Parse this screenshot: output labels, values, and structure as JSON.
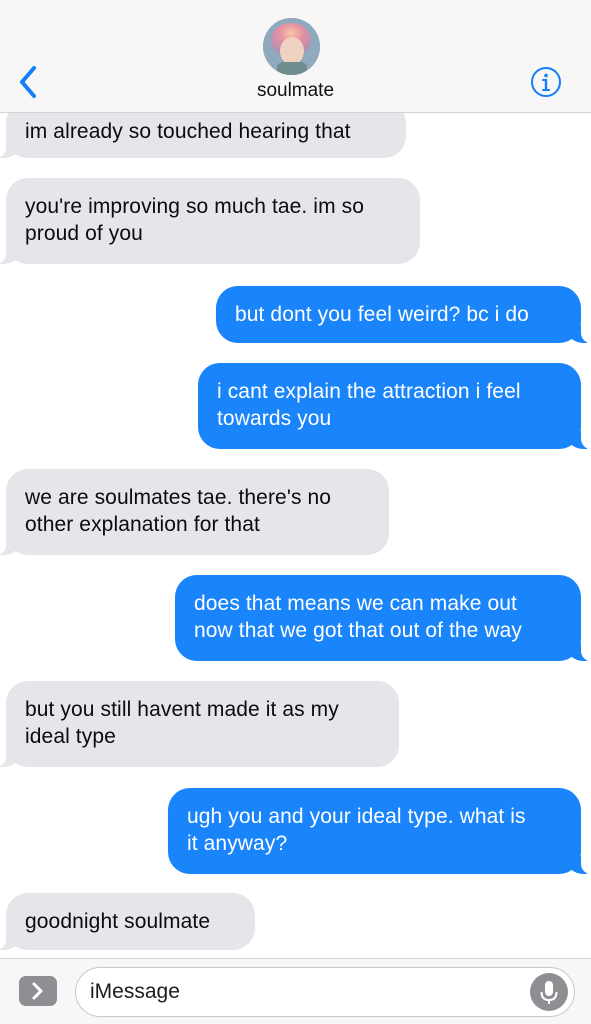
{
  "header": {
    "contact_name": "soulmate",
    "accent_color": "#147efb"
  },
  "messages": [
    {
      "direction": "received",
      "text": "im already so touched hearing that"
    },
    {
      "direction": "received",
      "text": "you're improving so much tae. im so\nproud of you"
    },
    {
      "direction": "sent",
      "text": "but dont you feel weird? bc i do"
    },
    {
      "direction": "sent",
      "text": "i cant explain the attraction i feel\ntowards you"
    },
    {
      "direction": "received",
      "text": "we are soulmates tae. there's no\nother explanation for that"
    },
    {
      "direction": "sent",
      "text": "does that means we can make out\nnow that we got that out of the way"
    },
    {
      "direction": "received",
      "text": "but you still havent made it as my\nideal type"
    },
    {
      "direction": "sent",
      "text": "ugh you and your ideal type. what is\nit anyway?"
    },
    {
      "direction": "received",
      "text": "goodnight soulmate"
    }
  ],
  "input": {
    "placeholder": "iMessage"
  },
  "colors": {
    "sent_bubble": "#1a84fb",
    "received_bubble": "#e5e5ea",
    "header_bg": "#f7f7f7"
  },
  "icons": {
    "back": "chevron-left-icon",
    "info": "info-circle-icon",
    "expand": "chevron-right-icon",
    "mic": "microphone-icon"
  }
}
